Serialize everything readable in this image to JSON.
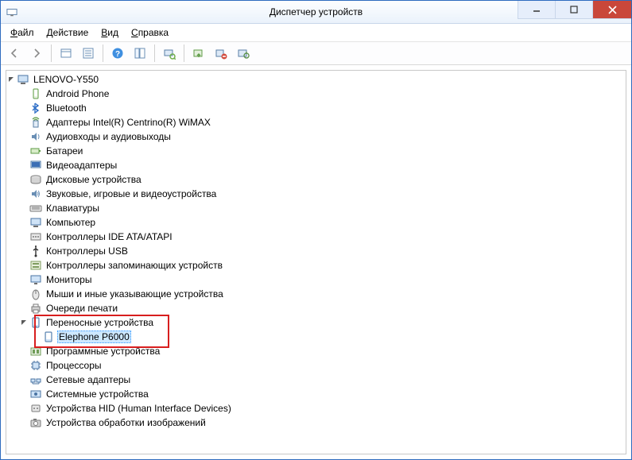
{
  "window": {
    "title": "Диспетчер устройств",
    "controls": {
      "minimize": "minimize",
      "maximize": "maximize",
      "close": "close"
    }
  },
  "menu": {
    "file": "Файл",
    "action": "Действие",
    "view": "Вид",
    "help": "Справка"
  },
  "toolbar": [
    "back",
    "forward",
    "sep",
    "show-hidden",
    "properties",
    "sep",
    "help",
    "sep",
    "scan",
    "sep",
    "update-driver",
    "uninstall",
    "disable"
  ],
  "tree": {
    "root": {
      "label": "LENOVO-Y550",
      "icon": "computer-icon",
      "expanded": true,
      "children": [
        {
          "label": "Android Phone",
          "icon": "phone-icon",
          "expanded": false
        },
        {
          "label": "Bluetooth",
          "icon": "bluetooth-icon",
          "expanded": false
        },
        {
          "label": "Адаптеры Intel(R) Centrino(R) WiMAX",
          "icon": "wimax-icon",
          "expanded": false
        },
        {
          "label": "Аудиовходы и аудиовыходы",
          "icon": "audio-icon",
          "expanded": false
        },
        {
          "label": "Батареи",
          "icon": "battery-icon",
          "expanded": false
        },
        {
          "label": "Видеоадаптеры",
          "icon": "display-adapter-icon",
          "expanded": false
        },
        {
          "label": "Дисковые устройства",
          "icon": "disk-icon",
          "expanded": false
        },
        {
          "label": "Звуковые, игровые и видеоустройства",
          "icon": "sound-icon",
          "expanded": false
        },
        {
          "label": "Клавиатуры",
          "icon": "keyboard-icon",
          "expanded": false
        },
        {
          "label": "Компьютер",
          "icon": "pc-icon",
          "expanded": false
        },
        {
          "label": "Контроллеры IDE ATA/ATAPI",
          "icon": "ide-icon",
          "expanded": false
        },
        {
          "label": "Контроллеры USB",
          "icon": "usb-icon",
          "expanded": false
        },
        {
          "label": "Контроллеры запоминающих устройств",
          "icon": "storage-controller-icon",
          "expanded": false
        },
        {
          "label": "Мониторы",
          "icon": "monitor-icon",
          "expanded": false
        },
        {
          "label": "Мыши и иные указывающие устройства",
          "icon": "mouse-icon",
          "expanded": false
        },
        {
          "label": "Очереди печати",
          "icon": "printer-icon",
          "expanded": false
        },
        {
          "label": "Переносные устройства",
          "icon": "portable-icon",
          "expanded": true,
          "children": [
            {
              "label": "Elephone P6000",
              "icon": "device-icon",
              "selected": true
            }
          ]
        },
        {
          "label": "Программные устройства",
          "icon": "software-device-icon",
          "expanded": false
        },
        {
          "label": "Процессоры",
          "icon": "cpu-icon",
          "expanded": false
        },
        {
          "label": "Сетевые адаптеры",
          "icon": "network-icon",
          "expanded": false
        },
        {
          "label": "Системные устройства",
          "icon": "system-icon",
          "expanded": false
        },
        {
          "label": "Устройства HID (Human Interface Devices)",
          "icon": "hid-icon",
          "expanded": false
        },
        {
          "label": "Устройства обработки изображений",
          "icon": "imaging-icon",
          "expanded": false
        }
      ]
    }
  },
  "highlight": {
    "targets": [
      "Переносные устройства",
      "Elephone P6000"
    ]
  }
}
